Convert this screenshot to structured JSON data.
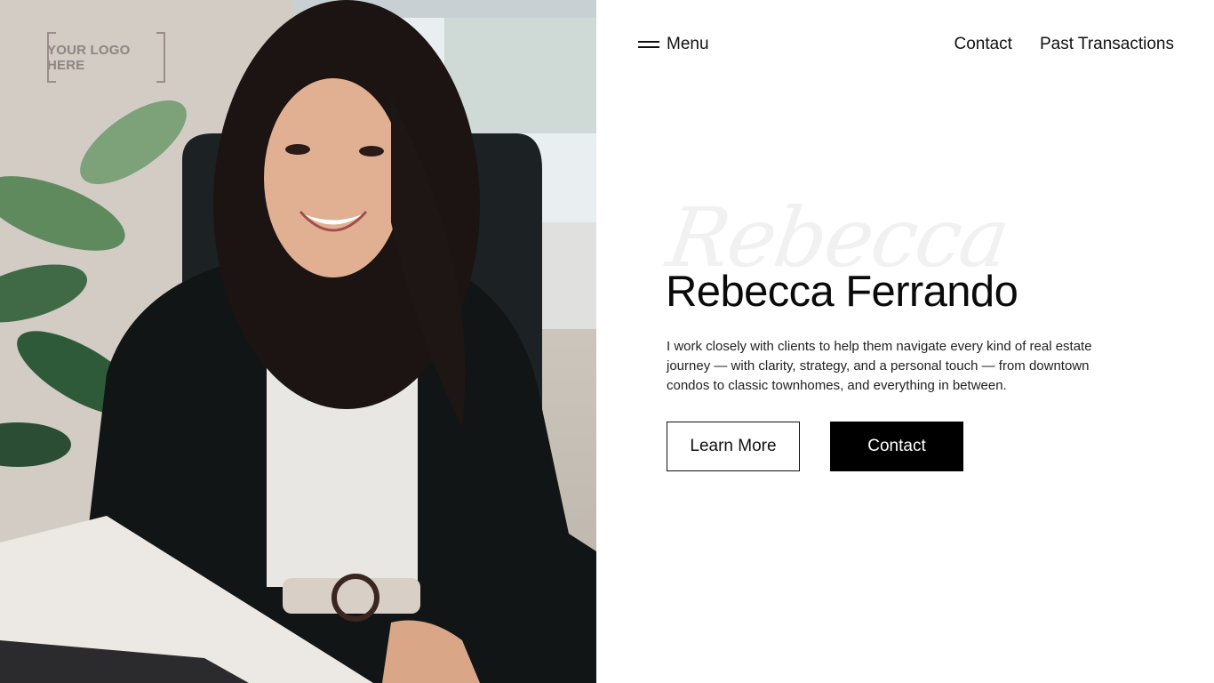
{
  "logo": {
    "text": "YOUR LOGO HERE"
  },
  "nav": {
    "menu_label": "Menu",
    "links": [
      "Contact",
      "Past Transactions"
    ]
  },
  "hero": {
    "script_text": "Rebecca",
    "name": "Rebecca Ferrando",
    "description": "I work closely with clients to help them navigate every kind of real estate journey — with clarity, strategy, and a personal touch — from downtown condos to classic townhomes, and everything in between.",
    "buttons": {
      "learn_more": "Learn More",
      "contact": "Contact"
    }
  },
  "colors": {
    "background": "#ffffff",
    "text": "#111111",
    "button_solid": "#000000",
    "logo": "#8f8383"
  },
  "icons": {
    "menu": "hamburger-icon"
  }
}
